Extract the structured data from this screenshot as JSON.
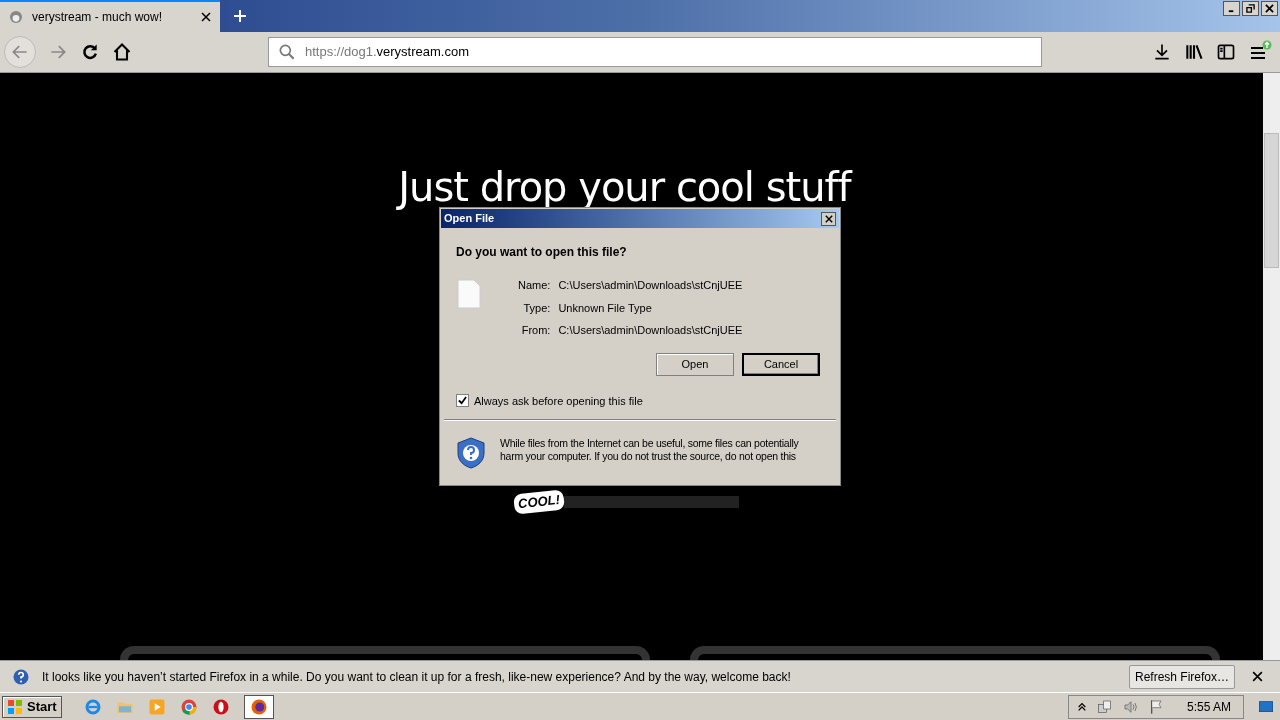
{
  "browser": {
    "tabs": [
      {
        "title": "verystream - much wow!",
        "selected": true
      }
    ],
    "url_prefix": "https://dog1.",
    "url_domain": "verystream.com"
  },
  "page": {
    "heading": "Just drop your cool stuff",
    "logo_text": "COOL!"
  },
  "dialog": {
    "title": "Open File",
    "question": "Do you want to open this file?",
    "fields": [
      {
        "label": "Name:",
        "value": "C:\\Users\\admin\\Downloads\\stCnjUEE"
      },
      {
        "label": "Type:",
        "value": "Unknown File Type"
      },
      {
        "label": "From:",
        "value": "C:\\Users\\admin\\Downloads\\stCnjUEE"
      }
    ],
    "buttons": [
      {
        "label": "Open",
        "default": false
      },
      {
        "label": "Cancel",
        "default": true
      }
    ],
    "checkbox": {
      "label": "Always ask before opening this file",
      "checked": true
    },
    "warning": "While files from the Internet can be useful, some files can potentially harm your computer. If you do not trust the source, do not open this"
  },
  "notification": {
    "message": "It looks like you haven’t started Firefox in a while. Do you want to clean it up for a fresh, like-new experience? And by the way, welcome back!",
    "button": "Refresh Firefox…"
  },
  "taskbar": {
    "start": "Start",
    "clock": "5:55 AM"
  }
}
